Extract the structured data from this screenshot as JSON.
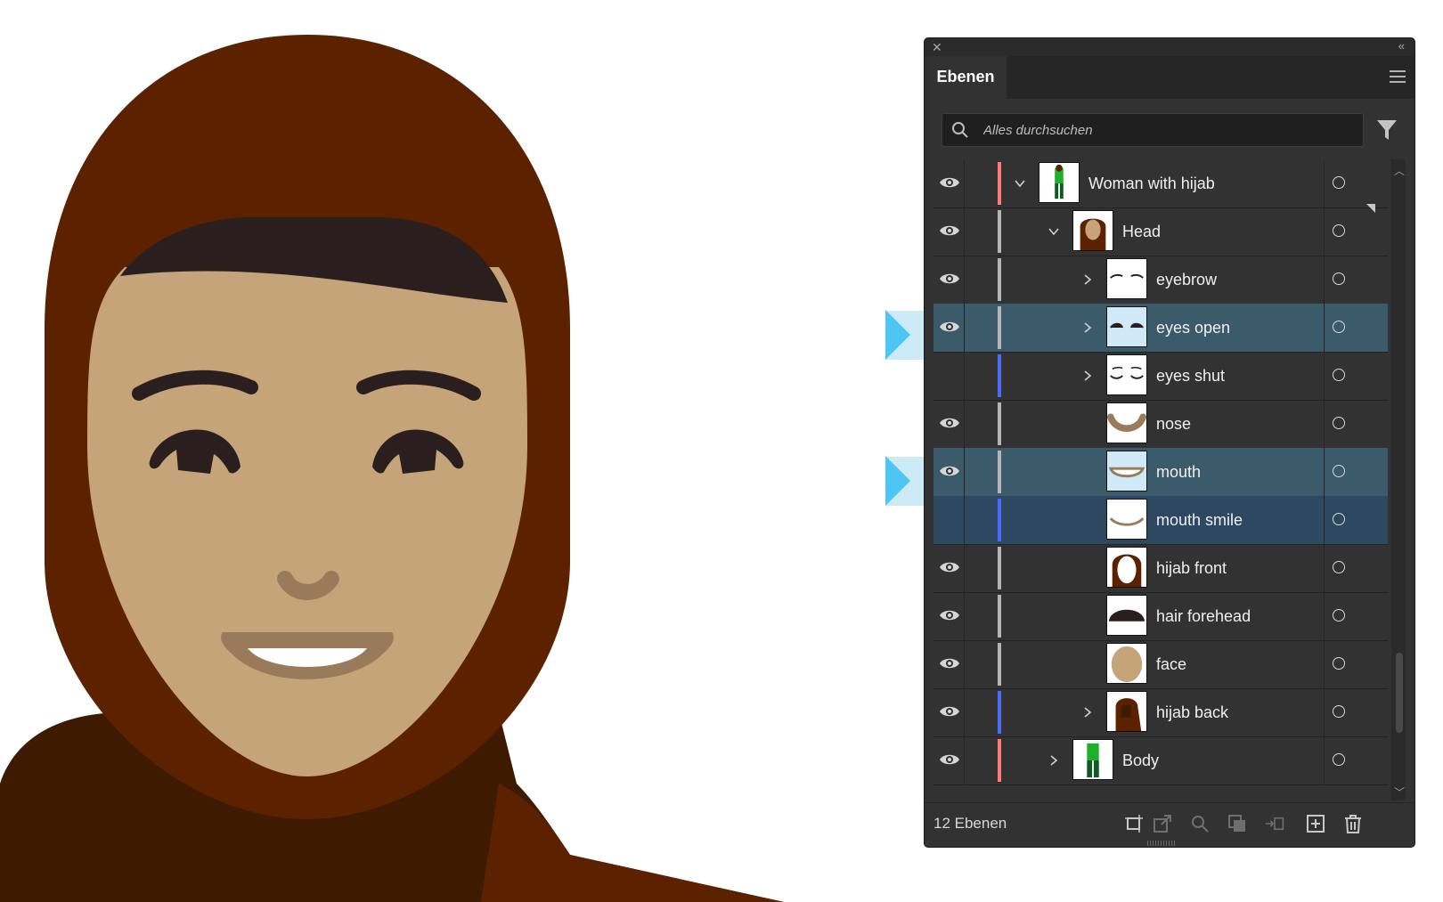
{
  "panel": {
    "close_glyph": "✕",
    "collapse_glyph": "«",
    "tab_label": "Ebenen",
    "menu_icon": "hamburger-menu-icon",
    "search_placeholder": "Alles durchsuchen",
    "filter_icon": "filter-funnel-icon",
    "layer_count": "12 Ebenen",
    "footer_icons": [
      "artboard-icon",
      "export-icon",
      "locate-icon",
      "clip-mask-icon",
      "collect-icon",
      "new-layer-icon",
      "trash-icon"
    ]
  },
  "layers": [
    {
      "name": "Woman with hijab",
      "visible": true,
      "color": "#ff7a7a",
      "expanded": true,
      "chevron": "down"
    },
    {
      "name": "Head",
      "visible": true,
      "color": "#b5b5b5",
      "expanded": true,
      "chevron": "down"
    },
    {
      "name": "eyebrow",
      "visible": true,
      "color": "#b5b5b5",
      "chevron": "right"
    },
    {
      "name": "eyes open",
      "visible": true,
      "color": "#b5b5b5",
      "chevron": "right",
      "highlighted": true
    },
    {
      "name": "eyes shut",
      "visible": false,
      "color": "#4f6bff",
      "chevron": "right"
    },
    {
      "name": "nose",
      "visible": true,
      "color": "#b5b5b5"
    },
    {
      "name": "mouth",
      "visible": true,
      "color": "#b5b5b5",
      "highlighted": true
    },
    {
      "name": "mouth smile",
      "visible": false,
      "color": "#4f6bff",
      "selected": true
    },
    {
      "name": "hijab front",
      "visible": true,
      "color": "#b5b5b5"
    },
    {
      "name": "hair forehead",
      "visible": true,
      "color": "#b5b5b5"
    },
    {
      "name": "face",
      "visible": true,
      "color": "#b5b5b5"
    },
    {
      "name": "hijab back",
      "visible": true,
      "color": "#4f6bff",
      "chevron": "right"
    },
    {
      "name": "Body",
      "visible": true,
      "color": "#ff7a7a",
      "chevron": "right"
    }
  ],
  "colors": {
    "hijab": "#5c2200",
    "hijab_back": "#3e1a00",
    "skin": "#c6a47a",
    "hair": "#2a1f1e",
    "nose_mouth": "#997a5a",
    "teeth": "#ffffff",
    "panel_bg": "#323232",
    "selection": "#2e4862",
    "highlight_arrow": "#4ec6f3"
  }
}
